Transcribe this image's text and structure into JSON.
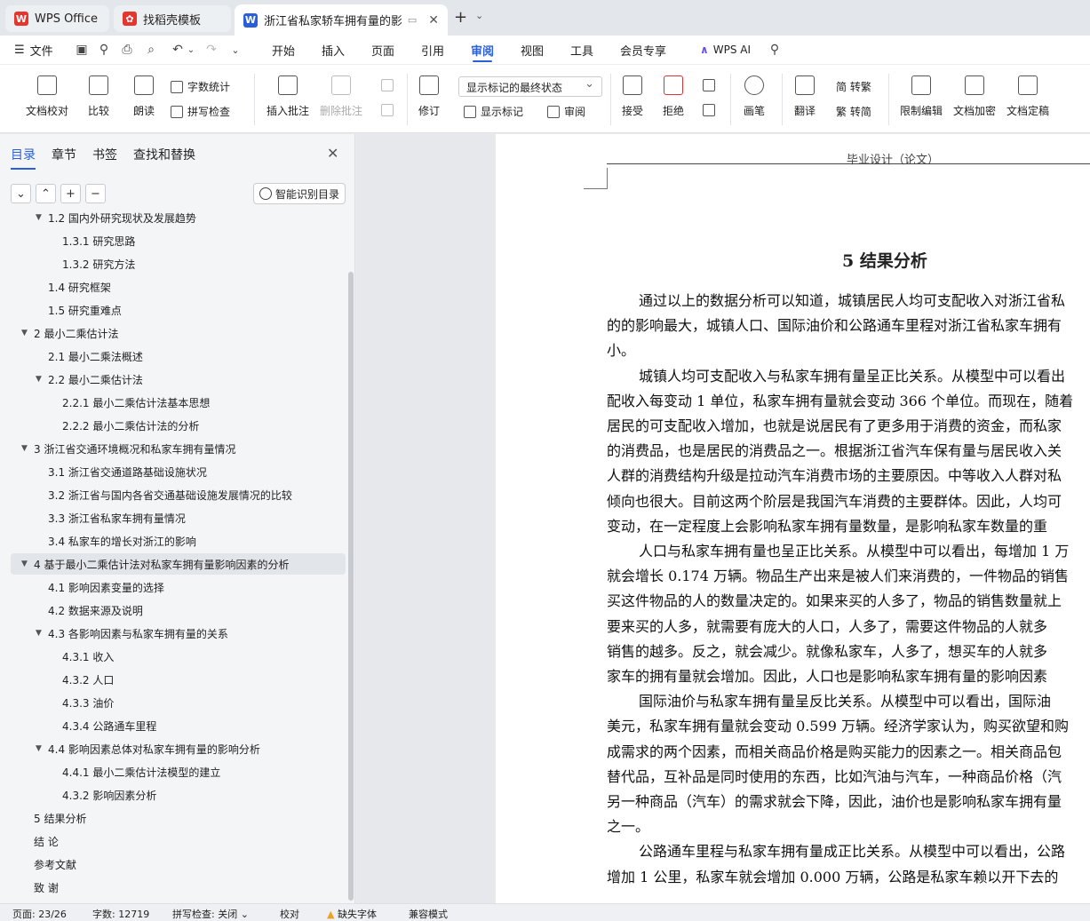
{
  "tabs": [
    {
      "label": "WPS Office",
      "icon": "wps-logo-icon",
      "color": "#e5352c"
    },
    {
      "label": "找稻壳模板",
      "icon": "docer-icon",
      "color": "#e5352c"
    },
    {
      "label": "浙江省私家轿车拥有量的影响因",
      "icon": "word-doc-icon",
      "color": "#2b5fd9"
    }
  ],
  "menu": {
    "file": "文件",
    "items": [
      "开始",
      "插入",
      "页面",
      "引用",
      "审阅",
      "视图",
      "工具",
      "会员专享"
    ],
    "active": "审阅",
    "wps_ai": "WPS AI"
  },
  "ribbon": {
    "doc_check": "文档校对",
    "compare": "比较",
    "read_aloud": "朗读",
    "word_count": "字数统计",
    "spell_check": "拼写检查",
    "insert_comment": "插入批注",
    "delete_comment": "删除批注",
    "track_changes": "修订",
    "markup_state": "显示标记的最终状态",
    "show_markup": "显示标记",
    "review_pane": "审阅",
    "accept": "接受",
    "reject": "拒绝",
    "pen": "画笔",
    "translate": "翻译",
    "to_traditional": "简 转繁",
    "to_simplified": "繁 转简",
    "restrict_edit": "限制编辑",
    "encrypt": "文档加密",
    "finalize": "文档定稿"
  },
  "panel": {
    "tabs": [
      "目录",
      "章节",
      "书签",
      "查找和替换"
    ],
    "active_tab": "目录",
    "smart_toc": "智能识别目录",
    "toc": [
      {
        "label": "1.2  国内外研究现状及发展趋势",
        "level": 2,
        "expandable": true
      },
      {
        "label": "1.3.1  研究思路",
        "level": 3
      },
      {
        "label": "1.3.2  研究方法",
        "level": 3
      },
      {
        "label": "1.4  研究框架",
        "level": 2
      },
      {
        "label": "1.5  研究重难点",
        "level": 2
      },
      {
        "label": "2  最小二乘估计法",
        "level": 1,
        "expandable": true
      },
      {
        "label": "2.1  最小二乘法概述",
        "level": 2
      },
      {
        "label": "2.2  最小二乘估计法",
        "level": 2,
        "expandable": true
      },
      {
        "label": "2.2.1  最小二乘估计法基本思想",
        "level": 3
      },
      {
        "label": "2.2.2  最小二乘估计法的分析",
        "level": 3
      },
      {
        "label": "3  浙江省交通环境概况和私家车拥有量情况",
        "level": 1,
        "expandable": true
      },
      {
        "label": "3.1  浙江省交通道路基础设施状况",
        "level": 2
      },
      {
        "label": "3.2  浙江省与国内各省交通基础设施发展情况的比较",
        "level": 2
      },
      {
        "label": "3.3  浙江省私家车拥有量情况",
        "level": 2
      },
      {
        "label": "3.4  私家车的增长对浙江的影响",
        "level": 2
      },
      {
        "label": "4  基于最小二乘估计法对私家车拥有量影响因素的分析",
        "level": 1,
        "expandable": true,
        "selected": true
      },
      {
        "label": "4.1  影响因素变量的选择",
        "level": 2
      },
      {
        "label": "4.2  数据来源及说明",
        "level": 2
      },
      {
        "label": "4.3  各影响因素与私家车拥有量的关系",
        "level": 2,
        "expandable": true
      },
      {
        "label": "4.3.1  收入",
        "level": 3
      },
      {
        "label": "4.3.2  人口",
        "level": 3
      },
      {
        "label": "4.3.3  油价",
        "level": 3
      },
      {
        "label": "4.3.4  公路通车里程",
        "level": 3
      },
      {
        "label": "4.4  影响因素总体对私家车拥有量的影响分析",
        "level": 2,
        "expandable": true
      },
      {
        "label": "4.4.1  最小二乘估计法模型的建立",
        "level": 3
      },
      {
        "label": "4.3.2  影响因素分析",
        "level": 3
      },
      {
        "label": "5  结果分析",
        "level": 1
      },
      {
        "label": "结  论",
        "level": 1
      },
      {
        "label": "参考文献",
        "level": 1
      },
      {
        "label": "致  谢",
        "level": 1
      }
    ]
  },
  "document": {
    "header": "毕业设计（论文）",
    "title": "5  结果分析",
    "lines": [
      {
        "text": "通过以上的数据分析可以知道，城镇居民人均可支配收入对浙江省私",
        "indent": true
      },
      {
        "text": "的的影响最大，城镇人口、国际油价和公路通车里程对浙江省私家车拥有",
        "indent": false
      },
      {
        "text": "小。",
        "indent": false
      },
      {
        "text": "城镇人均可支配收入与私家车拥有量呈正比关系。从模型中可以看出",
        "indent": true
      },
      {
        "text": "配收入每变动 1 单位，私家车拥有量就会变动 366 个单位。而现在，随着",
        "indent": false
      },
      {
        "text": "居民的可支配收入增加，也就是说居民有了更多用于消费的资金，而私家",
        "indent": false
      },
      {
        "text": "的消费品，也是居民的消费品之一。根据浙江省汽车保有量与居民收入关",
        "indent": false
      },
      {
        "text": "人群的消费结构升级是拉动汽车消费市场的主要原因。中等收入人群对私",
        "indent": false
      },
      {
        "text": "倾向也很大。目前这两个阶层是我国汽车消费的主要群体。因此，人均可",
        "indent": false
      },
      {
        "text": "变动，在一定程度上会影响私家车拥有量数量，是影响私家车数量的重",
        "indent": false
      },
      {
        "text": "人口与私家车拥有量也呈正比关系。从模型中可以看出，每增加 1 万",
        "indent": true
      },
      {
        "text": "就会增长 0.174 万辆。物品生产出来是被人们来消费的，一件物品的销售",
        "indent": false
      },
      {
        "text": "买这件物品的人的数量决定的。如果来买的人多了，物品的销售数量就上",
        "indent": false
      },
      {
        "text": "要来买的人多，就需要有庞大的人口，人多了，需要这件物品的人就多",
        "indent": false
      },
      {
        "text": "销售的越多。反之，就会减少。就像私家车，人多了，想买车的人就多",
        "indent": false
      },
      {
        "text": "家车的拥有量就会增加。因此，人口也是影响私家车拥有量的影响因素",
        "indent": false
      },
      {
        "text": "国际油价与私家车拥有量呈反比关系。从模型中可以看出，国际油",
        "indent": true
      },
      {
        "text": "美元，私家车拥有量就会变动 0.599 万辆。经济学家认为，购买欲望和购",
        "indent": false
      },
      {
        "text": "成需求的两个因素，而相关商品价格是购买能力的因素之一。相关商品包",
        "indent": false
      },
      {
        "text": "替代品，互补品是同时使用的东西，比如汽油与汽车，一种商品价格（汽",
        "indent": false
      },
      {
        "text": "另一种商品（汽车）的需求就会下降，因此，油价也是影响私家车拥有量",
        "indent": false
      },
      {
        "text": "之一。",
        "indent": false
      },
      {
        "text": "公路通车里程与私家车拥有量成正比关系。从模型中可以看出，公路",
        "indent": true
      },
      {
        "text": "增加 1 公里，私家车就会增加 0.000 万辆，公路是私家车赖以开下去的",
        "indent": false
      }
    ]
  },
  "status": {
    "page": "页面: 23/26",
    "words": "字数: 12719",
    "spell": "拼写检查: 关闭",
    "proofread": "校对",
    "missing_font": "缺失字体",
    "compat": "兼容模式"
  },
  "colors": {
    "accent": "#2b5fd9",
    "warning": "#f0a020"
  }
}
